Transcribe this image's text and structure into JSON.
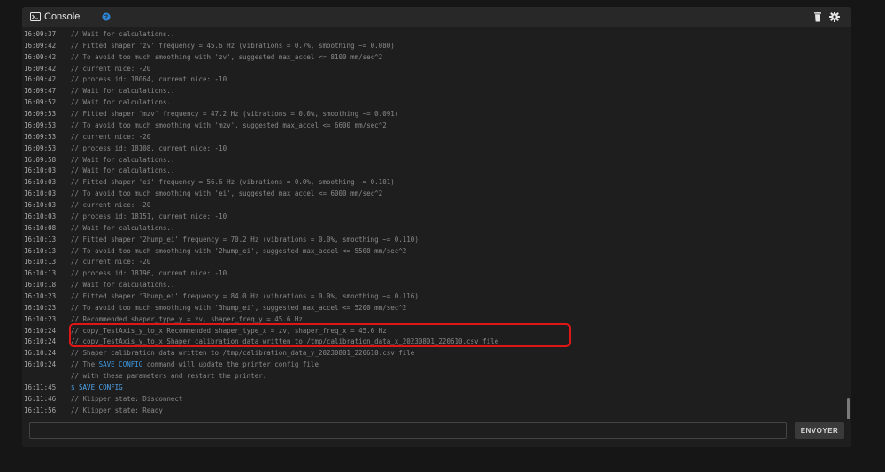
{
  "header": {
    "title": "Console",
    "icon": "terminal-icon",
    "help_icon": "help-circle-icon",
    "actions": [
      "trash-icon",
      "gear-icon"
    ]
  },
  "colors": {
    "accent": "#3d9be6",
    "highlight_box": "#e01515",
    "background": "#1e1e1e"
  },
  "log": [
    {
      "time": "16:09:37",
      "msg": "// Wait for calculations.."
    },
    {
      "time": "16:09:42",
      "msg": "// Fitted shaper 'zv' frequency = 45.6 Hz (vibrations = 0.7%, smoothing ~= 0.080)"
    },
    {
      "time": "16:09:42",
      "msg": "// To avoid too much smoothing with 'zv', suggested max_accel <= 8100 mm/sec^2"
    },
    {
      "time": "16:09:42",
      "msg": "// current nice: -20"
    },
    {
      "time": "16:09:42",
      "msg": "// process id: 18064, current nice: -10"
    },
    {
      "time": "16:09:47",
      "msg": "// Wait for calculations.."
    },
    {
      "time": "16:09:52",
      "msg": "// Wait for calculations.."
    },
    {
      "time": "16:09:53",
      "msg": "// Fitted shaper 'mzv' frequency = 47.2 Hz (vibrations = 0.0%, smoothing ~= 0.091)"
    },
    {
      "time": "16:09:53",
      "msg": "// To avoid too much smoothing with 'mzv', suggested max_accel <= 6600 mm/sec^2"
    },
    {
      "time": "16:09:53",
      "msg": "// current nice: -20"
    },
    {
      "time": "16:09:53",
      "msg": "// process id: 18108, current nice: -10"
    },
    {
      "time": "16:09:58",
      "msg": "// Wait for calculations.."
    },
    {
      "time": "16:10:03",
      "msg": "// Wait for calculations.."
    },
    {
      "time": "16:10:03",
      "msg": "// Fitted shaper 'ei' frequency = 56.6 Hz (vibrations = 0.0%, smoothing ~= 0.101)"
    },
    {
      "time": "16:10:03",
      "msg": "// To avoid too much smoothing with 'ei', suggested max_accel <= 6000 mm/sec^2"
    },
    {
      "time": "16:10:03",
      "msg": "// current nice: -20"
    },
    {
      "time": "16:10:03",
      "msg": "// process id: 18151, current nice: -10"
    },
    {
      "time": "16:10:08",
      "msg": "// Wait for calculations.."
    },
    {
      "time": "16:10:13",
      "msg": "// Fitted shaper '2hump_ei' frequency = 70.2 Hz (vibrations = 0.0%, smoothing ~= 0.110)"
    },
    {
      "time": "16:10:13",
      "msg": "// To avoid too much smoothing with '2hump_ei', suggested max_accel <= 5500 mm/sec^2"
    },
    {
      "time": "16:10:13",
      "msg": "// current nice: -20"
    },
    {
      "time": "16:10:13",
      "msg": "// process id: 18196, current nice: -10"
    },
    {
      "time": "16:10:18",
      "msg": "// Wait for calculations.."
    },
    {
      "time": "16:10:23",
      "msg": "// Fitted shaper '3hump_ei' frequency = 84.0 Hz (vibrations = 0.0%, smoothing ~= 0.116)"
    },
    {
      "time": "16:10:23",
      "msg": "// To avoid too much smoothing with '3hump_ei', suggested max_accel <= 5200 mm/sec^2"
    },
    {
      "time": "16:10:23",
      "msg": "// Recommended shaper_type_y = zv, shaper_freq_y = 45.6 Hz"
    },
    {
      "time": "16:10:24",
      "msg": "// copy_TestAxis_y_to_x Recommended shaper_type_x = zv, shaper_freq_x = 45.6 Hz"
    },
    {
      "time": "16:10:24",
      "msg": "// copy_TestAxis_y_to_x Shaper calibration data written to /tmp/calibration_data_x_20230801_220610.csv file"
    },
    {
      "time": "16:10:24",
      "msg": "// Shaper calibration data written to /tmp/calibration_data_y_20230801_220610.csv file"
    },
    {
      "time": "16:10:24",
      "msg_pre": "// The ",
      "msg_kw": "SAVE_CONFIG",
      "msg_post": " command will update the printer config file"
    },
    {
      "time": "",
      "msg": "// with these parameters and restart the printer."
    },
    {
      "time": "16:11:45",
      "msg": "$ SAVE_CONFIG",
      "type": "command"
    },
    {
      "time": "16:11:46",
      "msg": "// Klipper state: Disconnect"
    },
    {
      "time": "16:11:56",
      "msg": "// Klipper state: Ready"
    }
  ],
  "input": {
    "value": "",
    "placeholder": ""
  },
  "send_button": {
    "label": "ENVOYER"
  }
}
